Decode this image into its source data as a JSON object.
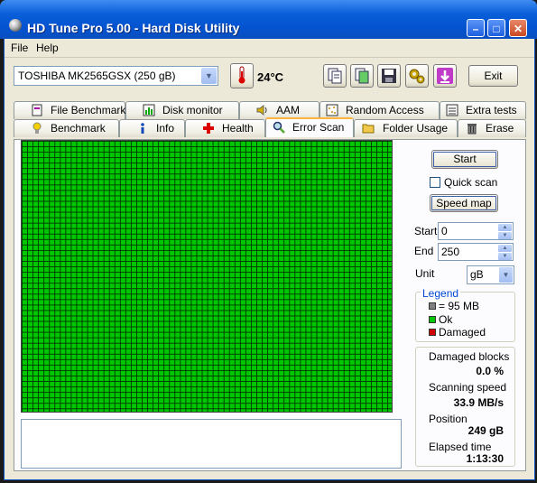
{
  "window": {
    "title": "HD Tune Pro 5.00 - Hard Disk Utility"
  },
  "menu": {
    "file": "File",
    "help": "Help"
  },
  "toolbar": {
    "drive": "TOSHIBA MK2565GSX (250 gB)",
    "temperature": "24°C",
    "exit_label": "Exit"
  },
  "tabs_top": [
    {
      "label": "File Benchmark",
      "icon": "file-benchmark-icon"
    },
    {
      "label": "Disk monitor",
      "icon": "disk-monitor-icon"
    },
    {
      "label": "AAM",
      "icon": "speaker-icon"
    },
    {
      "label": "Random Access",
      "icon": "random-access-icon"
    },
    {
      "label": "Extra tests",
      "icon": "extra-tests-icon"
    }
  ],
  "tabs_bottom": [
    {
      "label": "Benchmark",
      "icon": "benchmark-icon"
    },
    {
      "label": "Info",
      "icon": "info-icon"
    },
    {
      "label": "Health",
      "icon": "health-cross-icon"
    },
    {
      "label": "Error Scan",
      "icon": "magnifier-icon",
      "active": true
    },
    {
      "label": "Folder Usage",
      "icon": "folder-icon"
    },
    {
      "label": "Erase",
      "icon": "trash-icon"
    }
  ],
  "scan": {
    "start_button": "Start",
    "quick_scan_label": "Quick scan",
    "quick_scan_checked": false,
    "speed_map_button": "Speed map",
    "start_label": "Start",
    "start_value": "0",
    "end_label": "End",
    "end_value": "250",
    "unit_label": "Unit",
    "unit_value": "gB",
    "block_status": "ok",
    "block_color": "#00c800"
  },
  "legend": {
    "title": "Legend",
    "items": [
      {
        "label": "= 95 MB",
        "color": "#808080"
      },
      {
        "label": "Ok",
        "color": "#00c800"
      },
      {
        "label": "Damaged",
        "color": "#d00000"
      }
    ]
  },
  "stats": {
    "damaged_blocks_label": "Damaged blocks",
    "damaged_blocks_value": "0.0 %",
    "scanning_speed_label": "Scanning speed",
    "scanning_speed_value": "33.9 MB/s",
    "position_label": "Position",
    "position_value": "249 gB",
    "elapsed_label": "Elapsed time",
    "elapsed_value": "1:13:30"
  }
}
